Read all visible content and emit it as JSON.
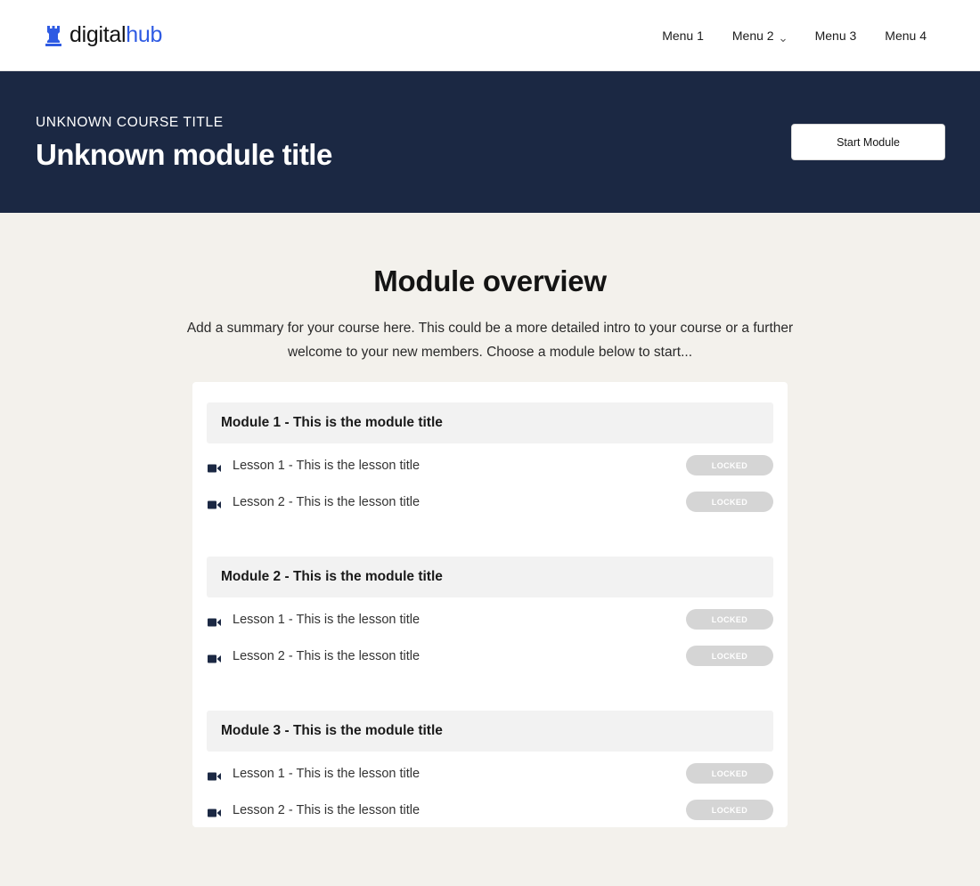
{
  "brand": {
    "name_part1": "digital",
    "name_part2": "hub",
    "icon": "castle-rook-icon",
    "accent_color": "#2f5be3"
  },
  "nav": {
    "items": [
      {
        "label": "Menu 1",
        "has_dropdown": false
      },
      {
        "label": "Menu 2",
        "has_dropdown": true
      },
      {
        "label": "Menu 3",
        "has_dropdown": false
      },
      {
        "label": "Menu 4",
        "has_dropdown": false
      }
    ]
  },
  "hero": {
    "course_title": "UNKNOWN COURSE TITLE",
    "module_title": "Unknown module title",
    "start_button_label": "Start Module",
    "background_color": "#1b2843"
  },
  "overview": {
    "title": "Module overview",
    "summary": "Add a summary for your course here. This could be a more detailed intro to your course or a further welcome to your new members. Choose a module below to start..."
  },
  "modules": [
    {
      "title": "Module 1 - This is the module title",
      "lessons": [
        {
          "title": "Lesson 1 - This is the lesson title",
          "status": "LOCKED",
          "icon": "video-camera-icon"
        },
        {
          "title": "Lesson 2 - This is the lesson title",
          "status": "LOCKED",
          "icon": "video-camera-icon"
        }
      ]
    },
    {
      "title": "Module 2 - This is the module title",
      "lessons": [
        {
          "title": "Lesson 1 - This is the lesson title",
          "status": "LOCKED",
          "icon": "video-camera-icon"
        },
        {
          "title": "Lesson 2 - This is the lesson title",
          "status": "LOCKED",
          "icon": "video-camera-icon"
        }
      ]
    },
    {
      "title": "Module 3 - This is the module title",
      "lessons": [
        {
          "title": "Lesson 1 - This is the lesson title",
          "status": "LOCKED",
          "icon": "video-camera-icon"
        },
        {
          "title": "Lesson 2 - This is the lesson title",
          "status": "LOCKED",
          "icon": "video-camera-icon"
        }
      ]
    }
  ]
}
